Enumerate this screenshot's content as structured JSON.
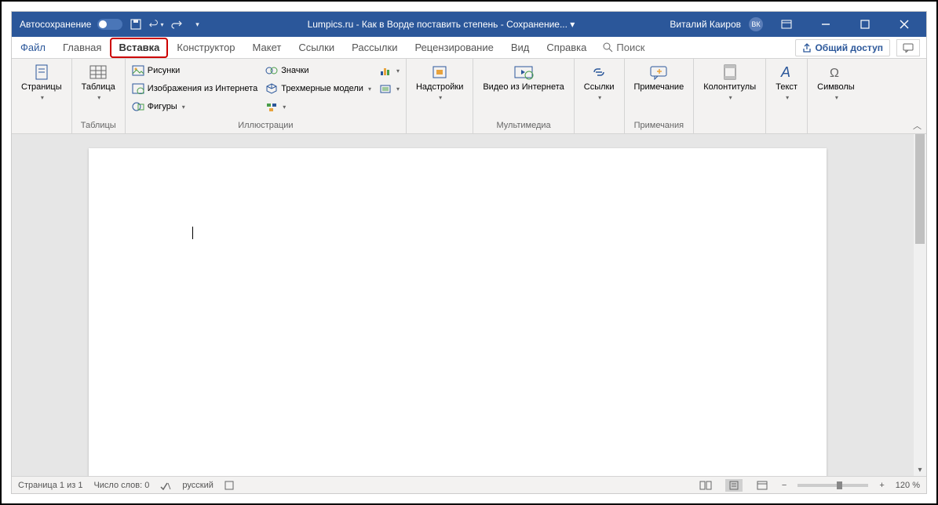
{
  "titlebar": {
    "autosave": "Автосохранение",
    "title": "Lumpics.ru - Как в Ворде поставить степень - Сохранение... ▾",
    "user": "Виталий Каиров",
    "initials": "ВК"
  },
  "tabs": {
    "file": "Файл",
    "home": "Главная",
    "insert": "Вставка",
    "design": "Конструктор",
    "layout": "Макет",
    "references": "Ссылки",
    "mailings": "Рассылки",
    "review": "Рецензирование",
    "view": "Вид",
    "help": "Справка",
    "search": "Поиск",
    "share": "Общий доступ"
  },
  "ribbon": {
    "pages": {
      "label": "Страницы",
      "group": ""
    },
    "tables": {
      "label": "Таблица",
      "group": "Таблицы"
    },
    "illustrations": {
      "pictures": "Рисунки",
      "online": "Изображения из Интернета",
      "shapes": "Фигуры",
      "icons": "Значки",
      "models3d": "Трехмерные модели",
      "group": "Иллюстрации"
    },
    "addins": {
      "label": "Надстройки"
    },
    "media": {
      "video": "Видео из Интернета",
      "group": "Мультимедиа"
    },
    "links": {
      "label": "Ссылки"
    },
    "comments": {
      "label": "Примечание",
      "group": "Примечания"
    },
    "headerfooter": {
      "label": "Колонтитулы"
    },
    "text": {
      "label": "Текст"
    },
    "symbols": {
      "label": "Символы"
    }
  },
  "status": {
    "page": "Страница 1 из 1",
    "words": "Число слов: 0",
    "lang": "русский",
    "zoom": "120 %"
  }
}
